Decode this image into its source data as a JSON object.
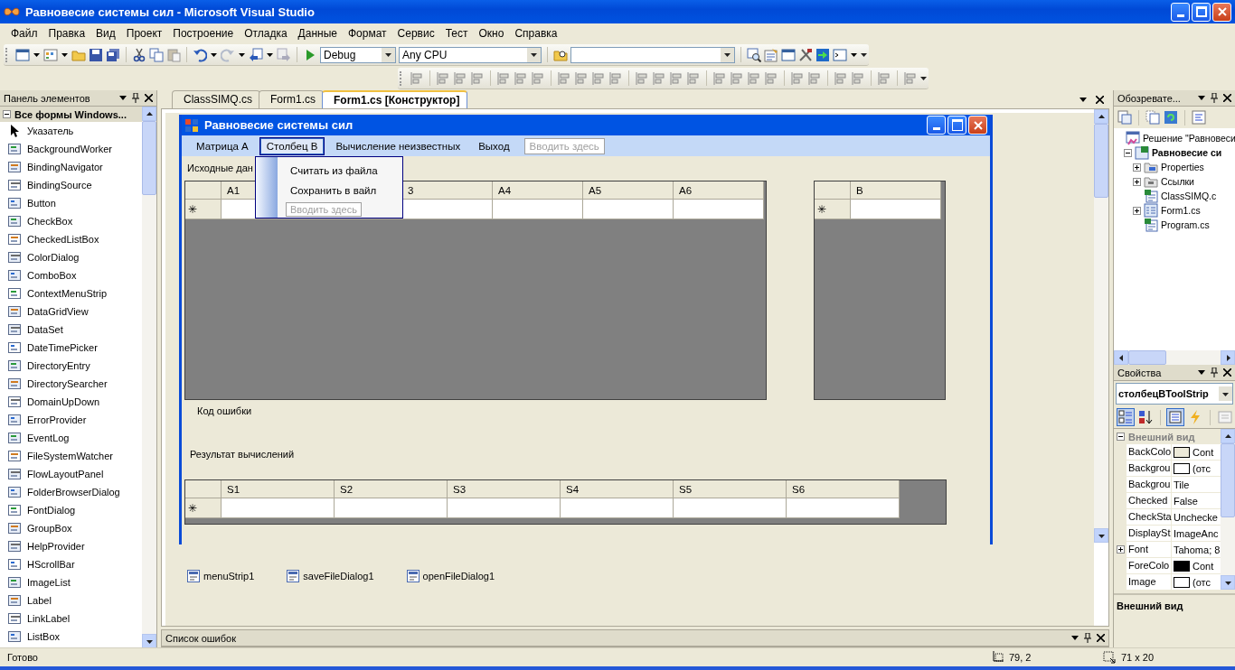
{
  "window": {
    "title": "Равновесие системы сил - Microsoft Visual Studio"
  },
  "menu": [
    "Файл",
    "Правка",
    "Вид",
    "Проект",
    "Построение",
    "Отладка",
    "Данные",
    "Формат",
    "Сервис",
    "Тест",
    "Окно",
    "Справка"
  ],
  "toolbar": {
    "configuration": "Debug",
    "platform": "Any CPU"
  },
  "toolbox": {
    "title": "Панель элементов",
    "group": {
      "label": "Все формы Windows...",
      "expanded": true
    },
    "items": [
      "Указатель",
      "BackgroundWorker",
      "BindingNavigator",
      "BindingSource",
      "Button",
      "CheckBox",
      "CheckedListBox",
      "ColorDialog",
      "ComboBox",
      "ContextMenuStrip",
      "DataGridView",
      "DataSet",
      "DateTimePicker",
      "DirectoryEntry",
      "DirectorySearcher",
      "DomainUpDown",
      "ErrorProvider",
      "EventLog",
      "FileSystemWatcher",
      "FlowLayoutPanel",
      "FolderBrowserDialog",
      "FontDialog",
      "GroupBox",
      "HelpProvider",
      "HScrollBar",
      "ImageList",
      "Label",
      "LinkLabel",
      "ListBox"
    ]
  },
  "editor_tabs": [
    {
      "label": "ClassSIMQ.cs",
      "selected": false
    },
    {
      "label": "Form1.cs",
      "selected": false
    },
    {
      "label": "Form1.cs [Конструктор]",
      "selected": true
    }
  ],
  "form": {
    "title": "Равновесие системы сил",
    "menu": [
      {
        "label": "Матрица A",
        "kind": "item",
        "selected": false
      },
      {
        "label": "Столбец B",
        "kind": "item",
        "selected": true
      },
      {
        "label": "Вычисление неизвестных",
        "kind": "item",
        "selected": false
      },
      {
        "label": "Выход",
        "kind": "item",
        "selected": false
      },
      {
        "label": "Вводить здесь",
        "kind": "placeholder"
      }
    ],
    "dropdown": [
      {
        "label": "Считать из файла",
        "kind": "item"
      },
      {
        "label": "Сохранить в вайл",
        "kind": "item"
      },
      {
        "label": "Вводить здесь",
        "kind": "placeholder"
      }
    ],
    "label_source": "Исходные дан",
    "grid_a": {
      "columns": [
        "A1",
        null,
        "3",
        "A4",
        "A5",
        "A6"
      ],
      "new_row_mark": "✳"
    },
    "grid_b": {
      "columns": [
        "B"
      ],
      "new_row_mark": "✳"
    },
    "label_error": "Код ошибки",
    "label_result": "Результат вычислений",
    "grid_s": {
      "columns": [
        "S1",
        "S2",
        "S3",
        "S4",
        "S5",
        "S6"
      ],
      "new_row_mark": "✳"
    }
  },
  "tray": [
    "menuStrip1",
    "saveFileDialog1",
    "openFileDialog1"
  ],
  "bottom_panel": {
    "title": "Список ошибок"
  },
  "solution_explorer": {
    "title": "Обозревате...",
    "tree": [
      {
        "label": "Решение \"Равновеси",
        "kind": "solution",
        "children": [
          {
            "label": "Равновесие си",
            "kind": "project",
            "expanded": true,
            "children": [
              {
                "label": "Properties",
                "kind": "properties",
                "expanded": false
              },
              {
                "label": "Ссылки",
                "kind": "references",
                "expanded": false
              },
              {
                "label": "ClassSIMQ.c",
                "kind": "code"
              },
              {
                "label": "Form1.cs",
                "kind": "form",
                "expanded": false
              },
              {
                "label": "Program.cs",
                "kind": "code"
              }
            ]
          }
        ]
      }
    ]
  },
  "properties": {
    "title": "Свойства",
    "object": "столбецBToolStrip",
    "category": {
      "label": "Внешний вид",
      "expanded": true
    },
    "rows": [
      {
        "name": "BackColo",
        "value": "Cont",
        "color": "#ece9d8"
      },
      {
        "name": "Backgrou",
        "value": "(отс",
        "color": "#ffffff"
      },
      {
        "name": "Backgrou",
        "value": "Tile"
      },
      {
        "name": "Checked",
        "value": "False"
      },
      {
        "name": "CheckSta",
        "value": "Unchecke"
      },
      {
        "name": "DisplaySt",
        "value": "ImageAnc"
      },
      {
        "name": "Font",
        "value": "Tahoma; 8",
        "expanded": false
      },
      {
        "name": "ForeColo",
        "value": "Cont",
        "color": "#000000"
      },
      {
        "name": "Image",
        "value": "(отс",
        "color": "#ffffff"
      }
    ],
    "description": "Внешний вид"
  },
  "status_bar": {
    "text": "Готово",
    "position": "79, 2",
    "size": "71 x 20"
  }
}
